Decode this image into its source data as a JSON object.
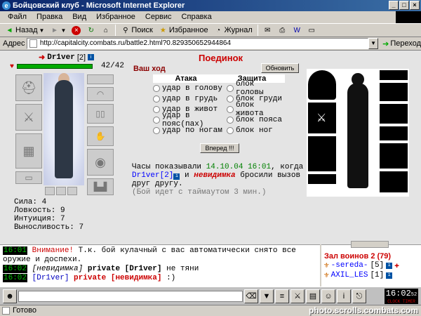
{
  "window": {
    "title": "Бойцовский клуб - Microsoft Internet Explorer",
    "buttons": [
      "_",
      "□",
      "×"
    ]
  },
  "menu": [
    "Файл",
    "Правка",
    "Вид",
    "Избранное",
    "Сервис",
    "Справка"
  ],
  "toolbar": {
    "back": "Назад",
    "search": "Поиск",
    "favorites": "Избранное",
    "journal": "Журнал"
  },
  "address": {
    "label": "Адрес",
    "url": "http://capitalcity.combats.ru/battle2.html?0.829350652944864",
    "go": "Переход"
  },
  "player": {
    "nick": "Dr1ver",
    "level": "[2]",
    "hp": "42/42",
    "stats": [
      {
        "label": "Сила:",
        "value": "4"
      },
      {
        "label": "Ловкость:",
        "value": "9"
      },
      {
        "label": "Интуиция:",
        "value": "7"
      },
      {
        "label": "Выносливость:",
        "value": "7"
      }
    ]
  },
  "battle": {
    "title": "Поединок",
    "your_turn": "Ваш ход",
    "refresh": "Обновить",
    "attack_header": "Атака",
    "defense_header": "Защита",
    "attacks": [
      "удар в голову",
      "удар в грудь",
      "удар в живот",
      "удар в пояс(пах)",
      "удар по ногам"
    ],
    "defenses": [
      "блок головы",
      "блок груди",
      "блок живота",
      "блок пояса",
      "блок ног"
    ],
    "forward": "Вперед !!!"
  },
  "log": {
    "prefix": "Часы показывали",
    "date": "14.10.04",
    "time": "16:01",
    "comma_when": ", когда",
    "nick1": "Dr1ver",
    "lvl1": "[2]",
    "and": "и",
    "nick2": "невидимка",
    "rest": "бросили вызов друг другу.",
    "timeout": "(Бой идет с таймаутом 3 мин.)"
  },
  "chat": [
    {
      "time": "16:01",
      "lead": "Внимание!",
      "text": "Т.к. бой кулачный с вас автоматически снято все оружие и доспехи."
    },
    {
      "time": "16:02",
      "nick": "[невидимка]",
      "priv": "private [Dr1ver]",
      "text": "не тяни"
    },
    {
      "time": "16:02",
      "nick": "[Dr1ver]",
      "priv": "private [невидимка]",
      "text": ":)"
    }
  ],
  "room": {
    "title": "Зал воинов 2 (79)",
    "users": [
      {
        "name": "-sereda-",
        "lvl": "[5]"
      },
      {
        "name": "AXIL_LES",
        "lvl": "[1]"
      }
    ]
  },
  "clock": {
    "time": "16:02",
    "sec": "52",
    "label": "CLOCK  TIMER"
  },
  "status": {
    "text": "Готово",
    "watermark": "photo.scrolls.combats.com"
  }
}
